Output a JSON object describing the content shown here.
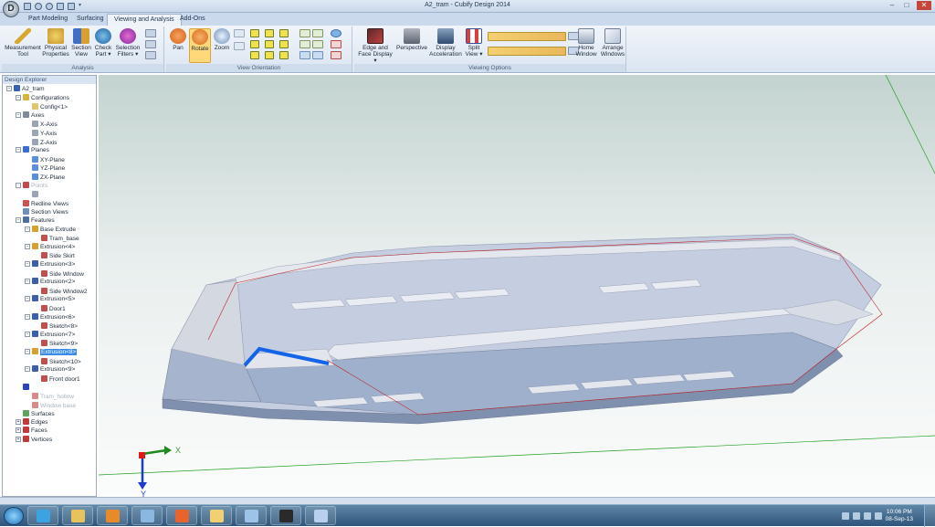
{
  "window": {
    "title": "A2_tram - Cubify Design 2014",
    "app_logo": "D",
    "controls": [
      "–",
      "□",
      "✕"
    ]
  },
  "menu_tabs": [
    "Part Modeling",
    "Surfacing",
    "Viewing and Analysis",
    "Add-Ons"
  ],
  "active_tab": "Viewing and Analysis",
  "ribbon": {
    "analysis": {
      "label": "Analysis",
      "measurement": "Measurement Tool",
      "physical": "Physical Properties",
      "section": "Section View",
      "check": "Check Part ▾",
      "selection": "Selection Filters ▾"
    },
    "orientation": {
      "label": "View Orientation",
      "pan": "Pan",
      "rotate": "Rotate",
      "zoom": "Zoom"
    },
    "viewing": {
      "label": "Viewing Options",
      "edge": "Edge and Face Display ▾",
      "perspective": "Perspective",
      "display": "Display Acceleration",
      "split": "Split View ▾",
      "home": "Home Window",
      "arrange": "Arrange Windows"
    }
  },
  "explorer": {
    "title": "Design Explorer",
    "items": [
      {
        "label": "A2_tram",
        "level": 0,
        "exp": "−",
        "icon": "#3461b6"
      },
      {
        "label": "Configurations",
        "level": 1,
        "exp": "−",
        "icon": "#d8b23a"
      },
      {
        "label": "Config<1>",
        "level": 2,
        "exp": "",
        "icon": "#e0c66a"
      },
      {
        "label": "Axes",
        "level": 1,
        "exp": "−",
        "icon": "#7f8a98"
      },
      {
        "label": "X-Axis",
        "level": 2,
        "exp": "",
        "icon": "#9aa5b3"
      },
      {
        "label": "Y-Axis",
        "level": 2,
        "exp": "",
        "icon": "#9aa5b3"
      },
      {
        "label": "Z-Axis",
        "level": 2,
        "exp": "",
        "icon": "#9aa5b3"
      },
      {
        "label": "Planes",
        "level": 1,
        "exp": "−",
        "icon": "#3b6fcf"
      },
      {
        "label": "XY-Plane",
        "level": 2,
        "exp": "",
        "icon": "#5c8ee0"
      },
      {
        "label": "YZ-Plane",
        "level": 2,
        "exp": "",
        "icon": "#5c8ee0"
      },
      {
        "label": "ZX-Plane",
        "level": 2,
        "exp": "",
        "icon": "#5c8ee0"
      },
      {
        "label": "Points",
        "level": 1,
        "exp": "−",
        "icon": "#c24a4a",
        "dim": true
      },
      {
        "label": "",
        "level": 2,
        "exp": "",
        "icon": "#9aa5b3"
      },
      {
        "label": "Redline Views",
        "level": 1,
        "exp": "",
        "icon": "#d05050"
      },
      {
        "label": "Section Views",
        "level": 1,
        "exp": "",
        "icon": "#6e8fba"
      },
      {
        "label": "Features",
        "level": 1,
        "exp": "−",
        "icon": "#4f6fa3"
      },
      {
        "label": "Base Extrude",
        "level": 2,
        "exp": "−",
        "icon": "#d8a02e"
      },
      {
        "label": "Tram_base",
        "level": 3,
        "exp": "",
        "icon": "#c05050"
      },
      {
        "label": "Extrusion<4>",
        "level": 2,
        "exp": "−",
        "icon": "#d8a02e"
      },
      {
        "label": "Side Skirt",
        "level": 3,
        "exp": "",
        "icon": "#c05050"
      },
      {
        "label": "Extrusion<3>",
        "level": 2,
        "exp": "−",
        "icon": "#3b5fa8"
      },
      {
        "label": "Side Window",
        "level": 3,
        "exp": "",
        "icon": "#c05050"
      },
      {
        "label": "Extrusion<2>",
        "level": 2,
        "exp": "−",
        "icon": "#3b5fa8"
      },
      {
        "label": "Side Window2",
        "level": 3,
        "exp": "",
        "icon": "#c05050"
      },
      {
        "label": "Extrusion<5>",
        "level": 2,
        "exp": "−",
        "icon": "#3b5fa8"
      },
      {
        "label": "Door1",
        "level": 3,
        "exp": "",
        "icon": "#c05050"
      },
      {
        "label": "Extrusion<6>",
        "level": 2,
        "exp": "−",
        "icon": "#3b5fa8"
      },
      {
        "label": "Sketch<8>",
        "level": 3,
        "exp": "",
        "icon": "#c05050"
      },
      {
        "label": "Extrusion<7>",
        "level": 2,
        "exp": "−",
        "icon": "#3b5fa8"
      },
      {
        "label": "Sketch<9>",
        "level": 3,
        "exp": "",
        "icon": "#c05050"
      },
      {
        "label": "Extrusion<8>",
        "level": 2,
        "exp": "−",
        "icon": "#d8a02e",
        "selected": true
      },
      {
        "label": "Sketch<10>",
        "level": 3,
        "exp": "",
        "icon": "#c05050"
      },
      {
        "label": "Extrusion<9>",
        "level": 2,
        "exp": "−",
        "icon": "#3b5fa8"
      },
      {
        "label": "Front door1",
        "level": 3,
        "exp": "",
        "icon": "#c05050"
      },
      {
        "label": "",
        "level": 1,
        "exp": "",
        "icon": "#2a44b8"
      },
      {
        "label": "Tram_hollow",
        "level": 2,
        "exp": "",
        "icon": "#d98a8a",
        "dim": true
      },
      {
        "label": "Window base",
        "level": 2,
        "exp": "",
        "icon": "#d98a8a",
        "dim": true
      },
      {
        "label": "Surfaces",
        "level": 1,
        "exp": "",
        "icon": "#5aa55a"
      },
      {
        "label": "Edges",
        "level": 1,
        "exp": "+",
        "icon": "#c03a3a"
      },
      {
        "label": "Faces",
        "level": 1,
        "exp": "+",
        "icon": "#c03a3a"
      },
      {
        "label": "Vertices",
        "level": 1,
        "exp": "+",
        "icon": "#c03a3a"
      }
    ]
  },
  "viewport": {
    "triad": {
      "x": "X",
      "y": "Y"
    },
    "colors": {
      "body_side": "#9fb0cd",
      "body_top": "#e4e7ee",
      "floor": "#c5cde0",
      "sketch_red": "#c02020",
      "selected_edge": "#1464e8",
      "grid_green": "#20a020"
    }
  },
  "taskbar": {
    "apps": [
      {
        "name": "internet-explorer",
        "color": "#3ca3e3"
      },
      {
        "name": "file-explorer",
        "color": "#e8c25a"
      },
      {
        "name": "media-player",
        "color": "#e88a2a"
      },
      {
        "name": "app-window",
        "color": "#8ab8e0"
      },
      {
        "name": "firefox",
        "color": "#e8642a"
      },
      {
        "name": "folder",
        "color": "#f0d070"
      },
      {
        "name": "network",
        "color": "#9dc3e8"
      },
      {
        "name": "cubify-design",
        "color": "#2a2a2a"
      },
      {
        "name": "editor",
        "color": "#b8d0ee"
      }
    ],
    "time": "10:06 PM",
    "date": "08-Sep-13"
  }
}
